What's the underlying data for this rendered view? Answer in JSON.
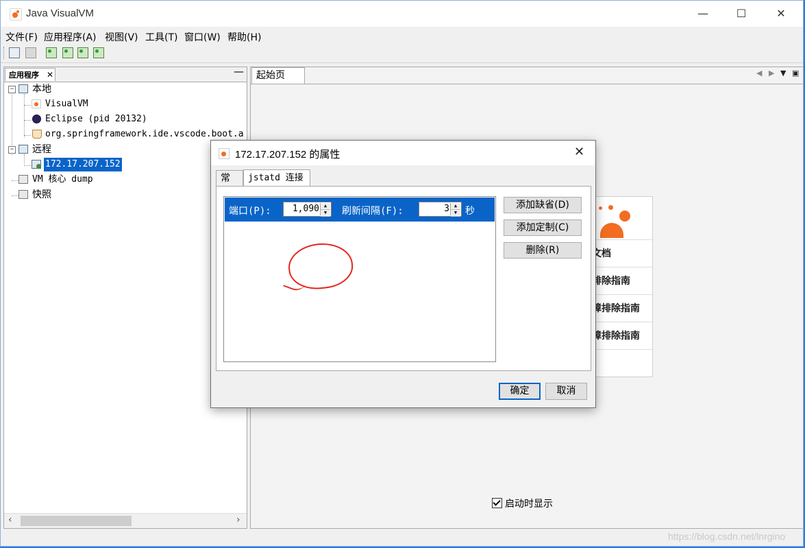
{
  "window": {
    "title": "Java VisualVM"
  },
  "menu": [
    "文件(F)",
    "应用程序(A)",
    "视图(V)",
    "工具(T)",
    "窗口(W)",
    "帮助(H)"
  ],
  "left_panel": {
    "tab_label": "应用程序",
    "tree": {
      "local": "本地",
      "local_items": [
        "VisualVM",
        "Eclipse (pid 20132)",
        "org.springframework.ide.vscode.boot.a"
      ],
      "remote": "远程",
      "remote_items": [
        "172.17.207.152"
      ],
      "vm_core_dump": "VM 核心 dump",
      "snapshots": "快照"
    }
  },
  "right_panel": {
    "tab_label": "起始页",
    "start_links": [
      "文档",
      "排除指南",
      "障排除指南",
      "障排除指南"
    ],
    "show_on_startup": "启动时显示",
    "show_on_startup_checked": true
  },
  "dialog": {
    "title": "172.17.207.152 的属性",
    "tabs": [
      "常规",
      "jstatd 连接"
    ],
    "active_tab": "jstatd 连接",
    "row": {
      "port_label": "端口(P):",
      "port_value": "1,090",
      "refresh_label": "刷新间隔(F):",
      "refresh_value": "3",
      "refresh_unit": "秒"
    },
    "side_buttons": [
      "添加缺省(D)",
      "添加定制(C)",
      "删除(R)"
    ],
    "ok": "确定",
    "cancel": "取消"
  },
  "watermark": "https://blog.csdn.net/lnrgino",
  "colors": {
    "selection": "#0a64c8",
    "annotation": "#e2261c",
    "brand": "#f26d21"
  }
}
